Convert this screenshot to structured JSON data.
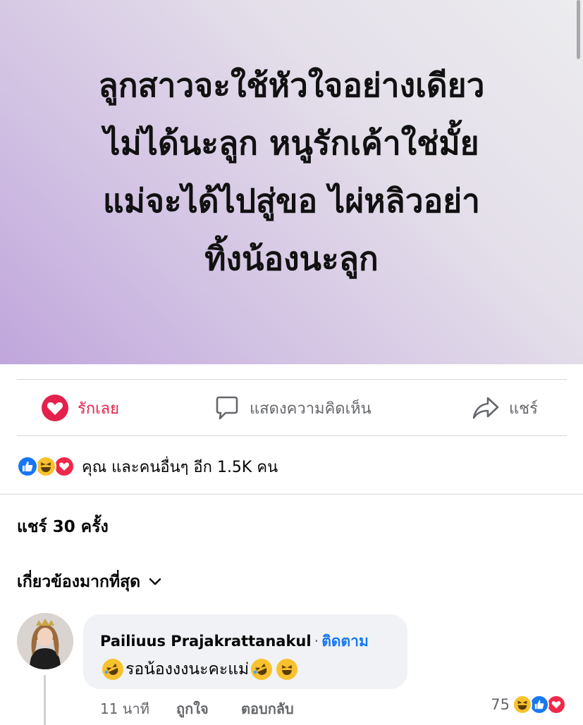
{
  "post": {
    "text_lines": [
      "ลูกสาวจะใช้หัวใจอย่างเดียว",
      "ไม่ได้นะลูก หนูรักเค้าใช่มั้ย",
      "แม่จะได้ไปสู่ขอ ไผ่หลิวอย่า",
      "ทิ้งน้องนะลูก"
    ]
  },
  "actions": {
    "love_label": "รักเลย",
    "comment_label": "แสดงความคิดเห็น",
    "share_label": "แชร์"
  },
  "reactions": {
    "summary": "คุณ และคนอื่นๆ อีก 1.5K คน",
    "icons": [
      "like-icon",
      "haha-icon",
      "love-icon"
    ]
  },
  "shares": {
    "label": "แชร์ 30 ครั้ง"
  },
  "sort": {
    "label": "เกี่ยวข้องมากที่สุด"
  },
  "comment": {
    "author": "Pailiuus Prajakrattanakul",
    "separator": "·",
    "follow_label": "ติดตาม",
    "text": "รอน้องงงนะคะแม่",
    "time": "11 นาที",
    "like_label": "ถูกใจ",
    "reply_label": "ตอบกลับ",
    "reaction_count": "75"
  },
  "colors": {
    "love": "#e4214c",
    "link": "#1877f2",
    "muted": "#65676b",
    "bubble": "#f0f2f5"
  }
}
